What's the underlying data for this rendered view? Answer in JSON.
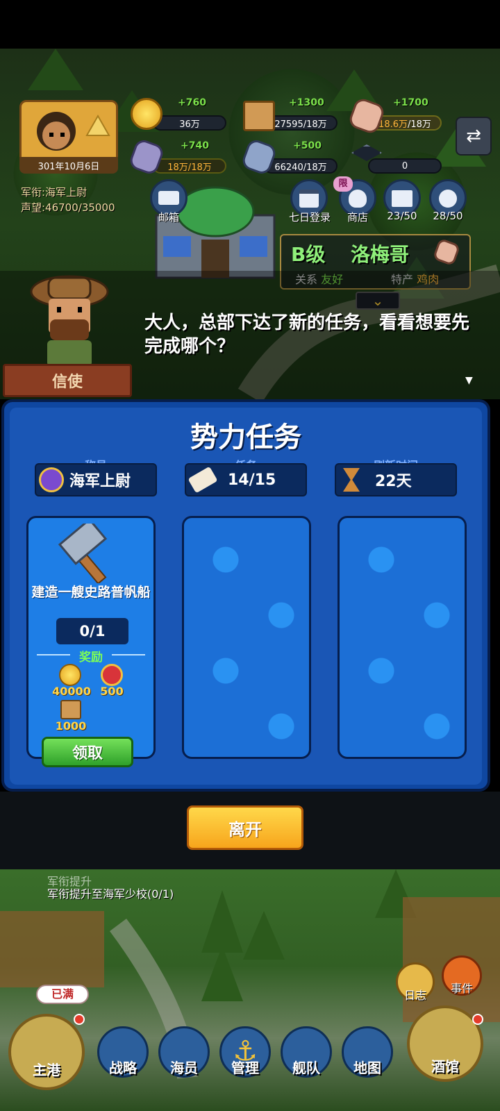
{
  "player": {
    "date": "301年10月6日",
    "rank_line": "军衔:海军上尉",
    "fame_line": "声望:46700/35000"
  },
  "resources": {
    "gold": {
      "income": "+760",
      "amount": "36万"
    },
    "wood": {
      "income": "+1300",
      "amount": "27595/18万"
    },
    "meat": {
      "income": "+1700",
      "amount_current": "18.6万",
      "amount_cap": "/18万"
    },
    "iron": {
      "income": "+740",
      "amount": "18万/18万"
    },
    "stone": {
      "income": "+500",
      "amount": "66240/18万"
    },
    "cap": {
      "amount": "0"
    }
  },
  "top_buttons": [
    {
      "name": "mailbox",
      "label": "邮箱"
    },
    {
      "name": "seven-day-login",
      "label": "七日登录"
    },
    {
      "name": "shop",
      "label": "商店",
      "badge": "限"
    },
    {
      "name": "book",
      "label": "23/50"
    },
    {
      "name": "crew",
      "label": "28/50"
    }
  ],
  "npc": {
    "grade": "B级",
    "name": "洛梅哥",
    "relation_label": "关系",
    "relation_value": "友好",
    "product_label": "特产",
    "product_value": "鸡肉"
  },
  "dialog": {
    "text": "大人，总部下达了新的任务，看看想要先完成哪个？",
    "speaker": "信使"
  },
  "faction_panel": {
    "title": "势力任务",
    "title_label": "称号",
    "title_value": "海军上尉",
    "task_label": "任务",
    "task_value": "14/15",
    "refresh_label": "刷新时间",
    "refresh_value": "22天"
  },
  "task_card": {
    "name": "建造一艘史路普帆船",
    "progress": "0/1",
    "reward_label": "奖励",
    "rewards": {
      "gold": "40000",
      "badge": "500",
      "wood": "1000"
    },
    "claim_label": "领取"
  },
  "leave_label": "离开",
  "quest_hint": {
    "title": "军衔提升",
    "text": "军衔提升至海军少校(0/1)"
  },
  "full_badge": "已满",
  "side_buttons": {
    "log": "日志",
    "event": "事件"
  },
  "bottom_nav": [
    {
      "name": "main-port",
      "label": "主港"
    },
    {
      "name": "strategy",
      "label": "战略"
    },
    {
      "name": "crew",
      "label": "海员"
    },
    {
      "name": "manage",
      "label": "管理"
    },
    {
      "name": "fleet",
      "label": "舰队"
    },
    {
      "name": "map",
      "label": "地图"
    },
    {
      "name": "tavern",
      "label": "酒馆"
    }
  ],
  "colors": {
    "panel": "#0f47a1",
    "accent_green": "#7be04a",
    "gold": "#ffd54a"
  }
}
